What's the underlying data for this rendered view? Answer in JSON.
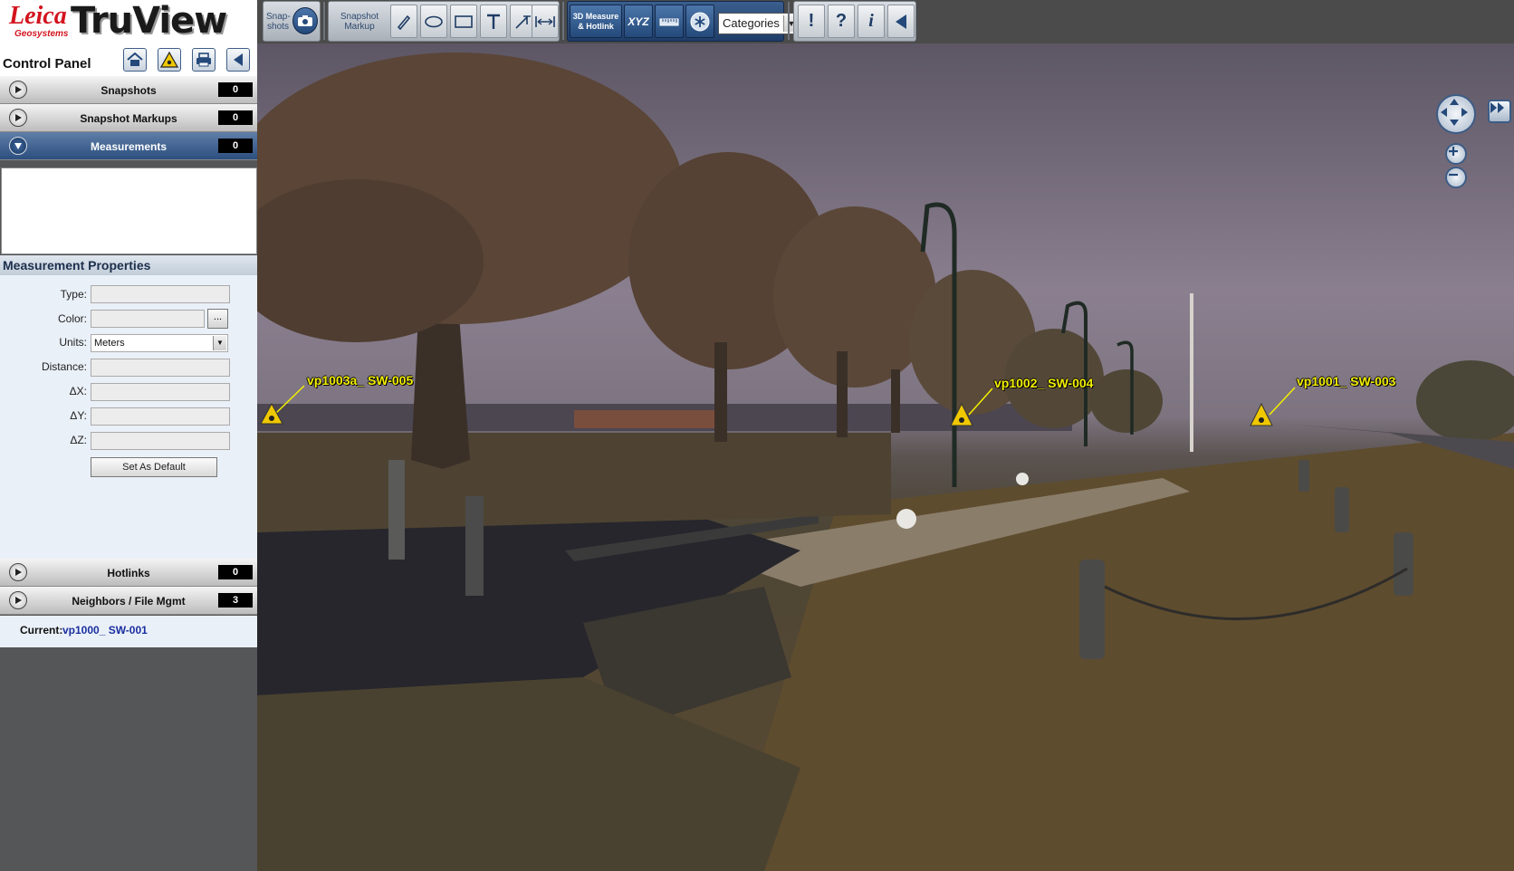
{
  "logo": {
    "brand": "Leica",
    "sub": "Geosystems",
    "product": "TruView"
  },
  "toolbar": {
    "snapshots_label": "Snap-\nshots",
    "snapshot_markup_label": "Snapshot\nMarkup",
    "measure_label": "3D Measure\n& Hotlink",
    "xyz_label": "XYZ",
    "categories": "Categories"
  },
  "control_panel": {
    "title": "Control Panel",
    "sections": [
      {
        "label": "Snapshots",
        "count": "0",
        "expanded": false
      },
      {
        "label": "Snapshot Markups",
        "count": "0",
        "expanded": false
      },
      {
        "label": "Measurements",
        "count": "0",
        "expanded": true
      },
      {
        "label": "Hotlinks",
        "count": "0",
        "expanded": false
      },
      {
        "label": "Neighbors / File Mgmt",
        "count": "3",
        "expanded": false
      }
    ],
    "measurement_properties": {
      "title": "Measurement Properties",
      "type_label": "Type:",
      "color_label": "Color:",
      "color_button": "...",
      "units_label": "Units:",
      "units_value": "Meters",
      "distance_label": "Distance:",
      "dx_label": "ΔX:",
      "dy_label": "ΔY:",
      "dz_label": "ΔZ:",
      "set_default": "Set As Default"
    },
    "current_label": "Current:",
    "current_value": "vp1000_ SW-001"
  },
  "hotlinks": [
    {
      "label": "vp1003a_ SW-005"
    },
    {
      "label": "vp1002_ SW-004"
    },
    {
      "label": "vp1001_ SW-003"
    }
  ],
  "colors": {
    "accent": "#2c4f7f",
    "hotlink": "#f4f000",
    "warning": "#f0c800"
  }
}
